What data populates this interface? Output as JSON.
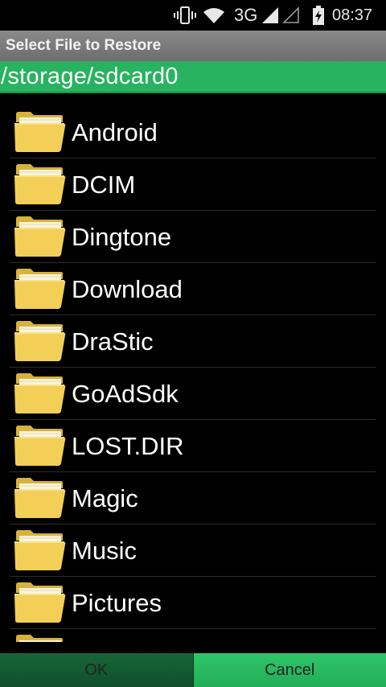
{
  "status_bar": {
    "network": "3G",
    "time": "08:37",
    "icons": [
      "vibrate-icon",
      "wifi-icon",
      "signal-icon",
      "signal-empty-icon",
      "battery-charging-icon"
    ]
  },
  "dialog": {
    "title": "Select File to Restore",
    "path": "/storage/sdcard0"
  },
  "files": [
    {
      "name": "Android",
      "type": "folder"
    },
    {
      "name": "DCIM",
      "type": "folder"
    },
    {
      "name": "Dingtone",
      "type": "folder"
    },
    {
      "name": "Download",
      "type": "folder"
    },
    {
      "name": "DraStic",
      "type": "folder"
    },
    {
      "name": "GoAdSdk",
      "type": "folder"
    },
    {
      "name": "LOST.DIR",
      "type": "folder"
    },
    {
      "name": "Magic",
      "type": "folder"
    },
    {
      "name": "Music",
      "type": "folder"
    },
    {
      "name": "Pictures",
      "type": "folder"
    },
    {
      "name": "",
      "type": "folder"
    }
  ],
  "buttons": {
    "ok_label": "OK",
    "cancel_label": "Cancel"
  },
  "colors": {
    "path_bar": "#27b35f",
    "title_bar": "#7c7c7c",
    "ok_button": "#145c34",
    "cancel_button": "#28b960",
    "folder": "#f3cf58"
  }
}
